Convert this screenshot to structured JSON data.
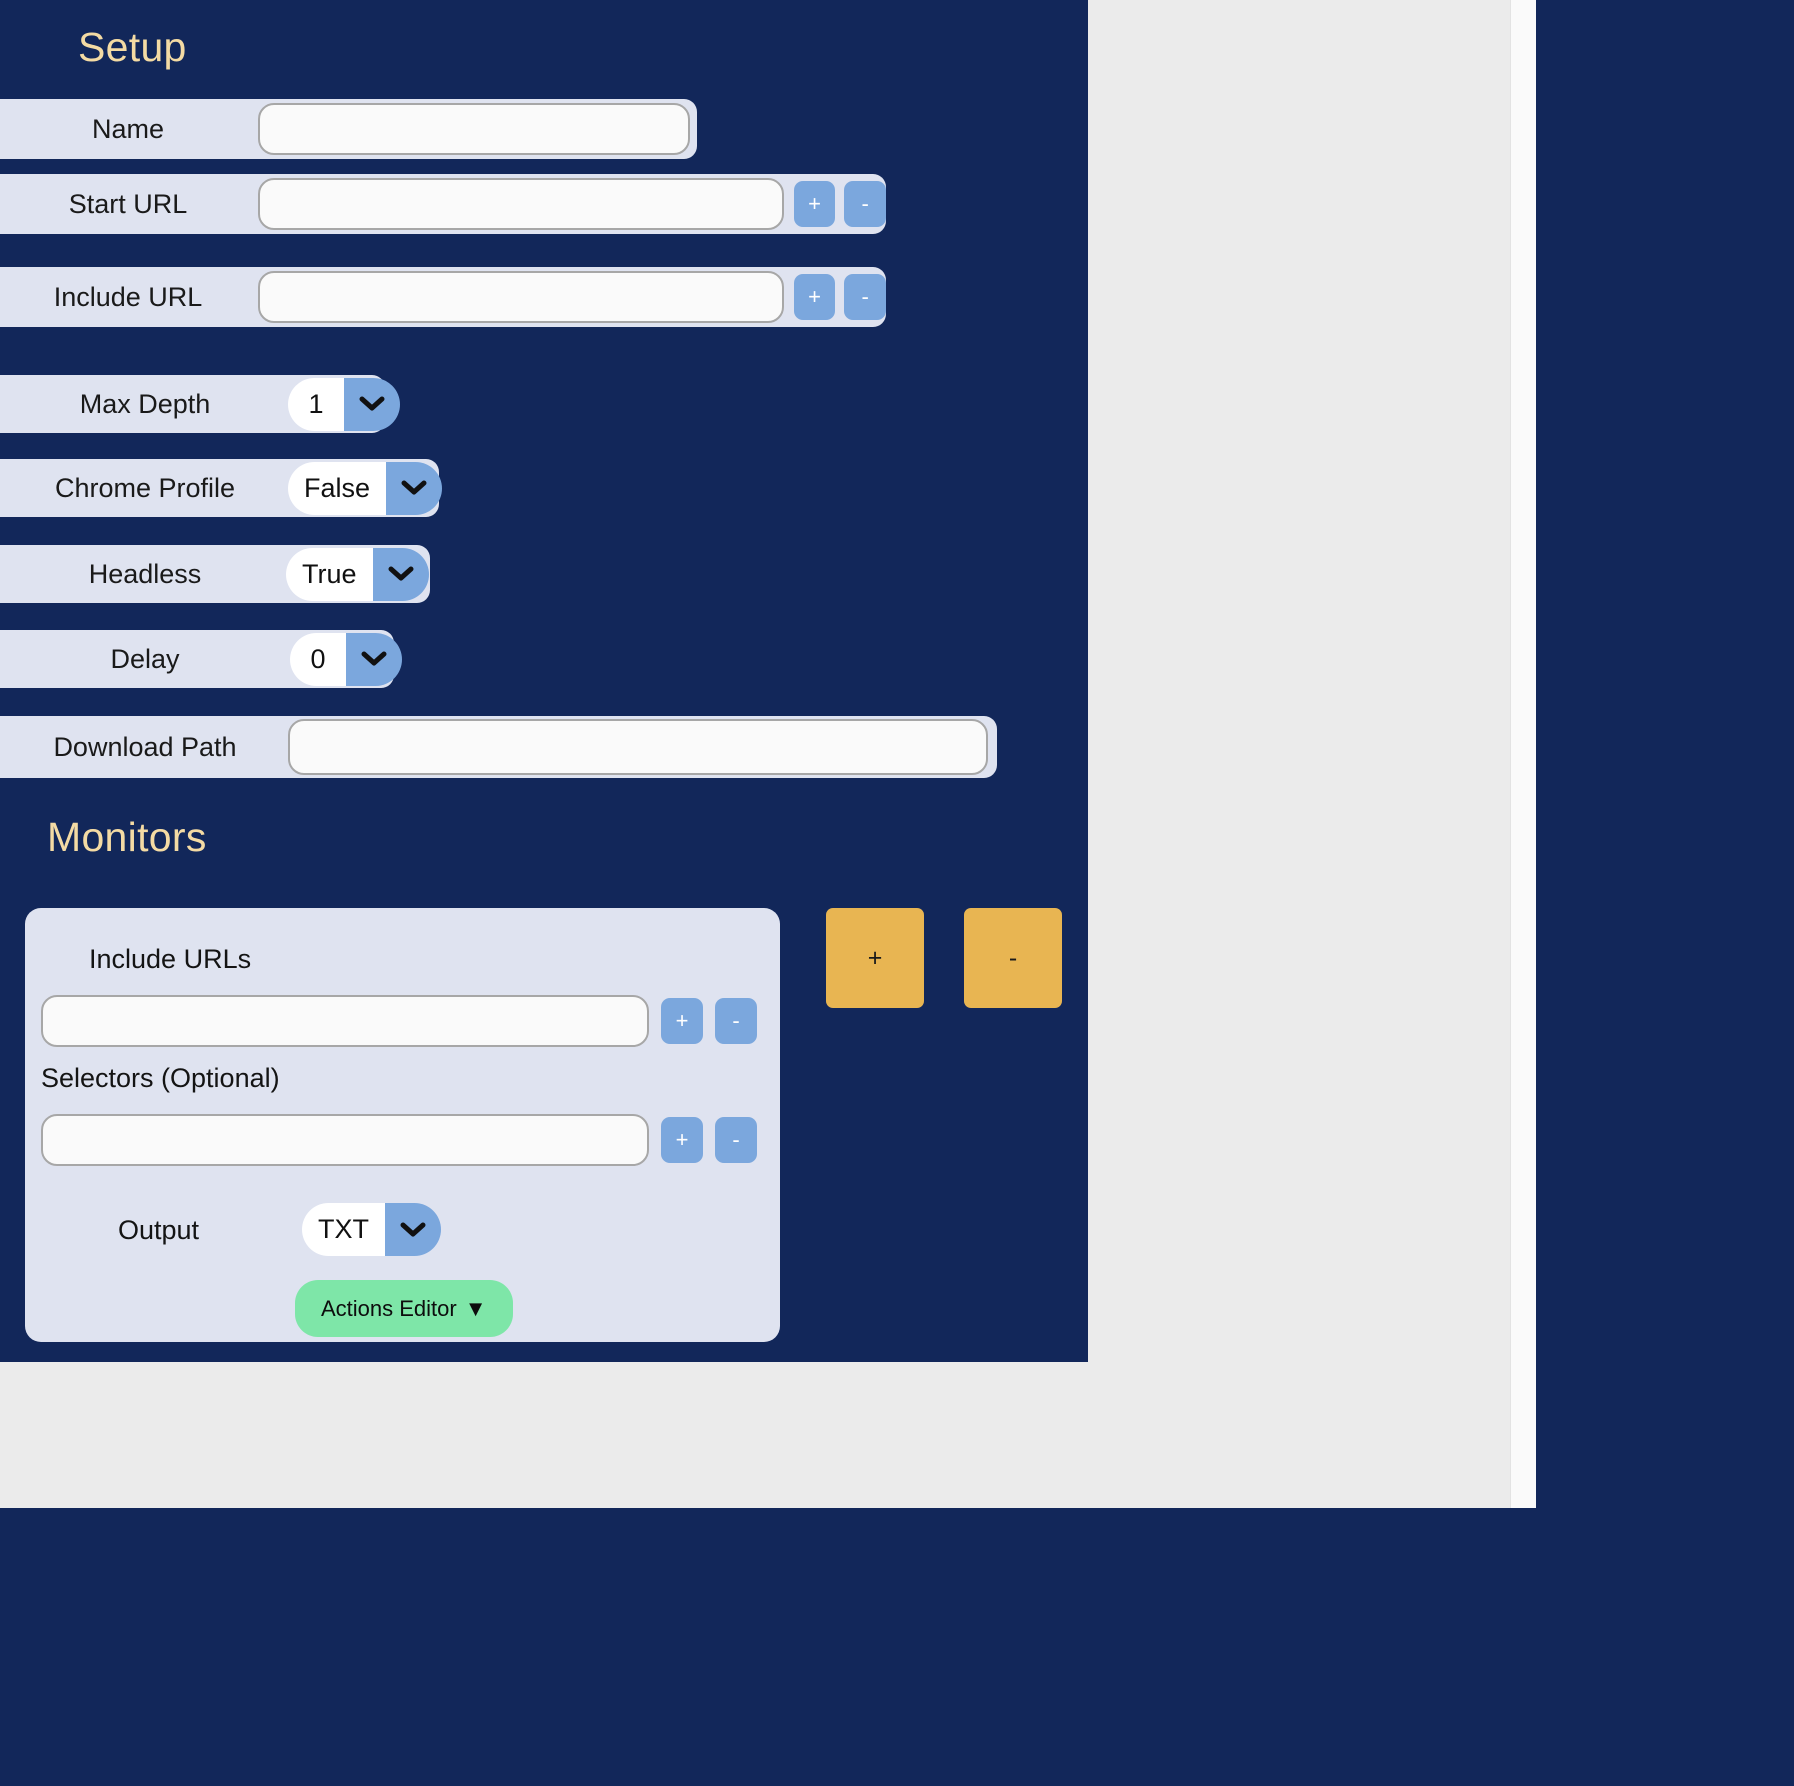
{
  "section_setup": {
    "title": "Setup",
    "fields": [
      {
        "label": "Name",
        "kind": "text",
        "value": "",
        "placeholder": ""
      },
      {
        "label": "Start URL",
        "kind": "text",
        "value": "",
        "placeholder": "",
        "add": "+",
        "remove": "-"
      },
      {
        "label": "Include URL",
        "kind": "text",
        "value": "",
        "placeholder": "",
        "add": "+",
        "remove": "-"
      },
      {
        "label": "Max Depth",
        "kind": "dropdown",
        "value": "1"
      },
      {
        "label": "Chrome Profile",
        "kind": "dropdown",
        "value": "False"
      },
      {
        "label": "Headless",
        "kind": "dropdown",
        "value": "True"
      },
      {
        "label": "Delay",
        "kind": "dropdown",
        "value": "0"
      },
      {
        "label": "Download Path",
        "kind": "text",
        "value": "",
        "placeholder": ""
      }
    ]
  },
  "section_monitors": {
    "title": "Monitors",
    "add_label": "+",
    "remove_label": "-",
    "card": {
      "include_urls_label": "Include URLs",
      "include_urls_value": "",
      "include_urls_placeholder": "",
      "include_add": "+",
      "include_remove": "-",
      "selectors_label": "Selectors (Optional)",
      "selectors_value": "",
      "selectors_placeholder": "",
      "selectors_add": "+",
      "selectors_remove": "-",
      "output_label": "Output",
      "output_value": "TXT",
      "actions_editor_label": "Actions Editor",
      "actions_editor_caret": "▼"
    }
  },
  "colors": {
    "panel_navy": "#12275a",
    "row_lavender": "#dfe3f0",
    "title_cream": "#f4dba4",
    "mini_blue": "#7ba7dd",
    "amber": "#e8b552",
    "green": "#7ee6a8",
    "page_gray": "#ebebeb"
  }
}
